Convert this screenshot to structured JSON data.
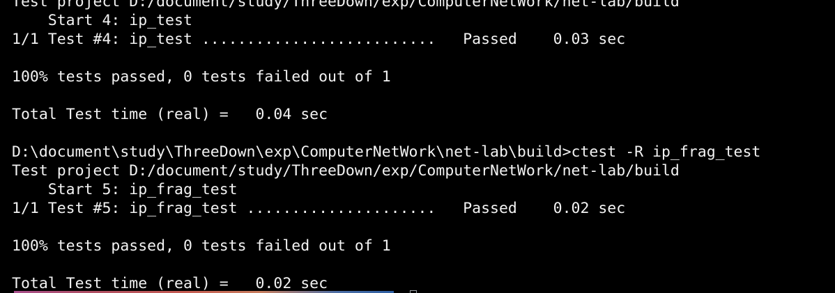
{
  "terminal": {
    "lines": [
      "Test project D:/document/study/ThreeDown/exp/ComputerNetWork/net-lab/build",
      "    Start 4: ip_test",
      "1/1 Test #4: ip_test ..........................   Passed    0.03 sec",
      "",
      "100% tests passed, 0 tests failed out of 1",
      "",
      "Total Test time (real) =   0.04 sec",
      "",
      "D:\\document\\study\\ThreeDown\\exp\\ComputerNetWork\\net-lab\\build>ctest -R ip_frag_test",
      "Test project D:/document/study/ThreeDown/exp/ComputerNetWork/net-lab/build",
      "    Start 5: ip_frag_test",
      "1/1 Test #5: ip_frag_test .....................   Passed    0.02 sec",
      "",
      "100% tests passed, 0 tests failed out of 1",
      "",
      "Total Test time (real) =   0.02 sec"
    ]
  }
}
